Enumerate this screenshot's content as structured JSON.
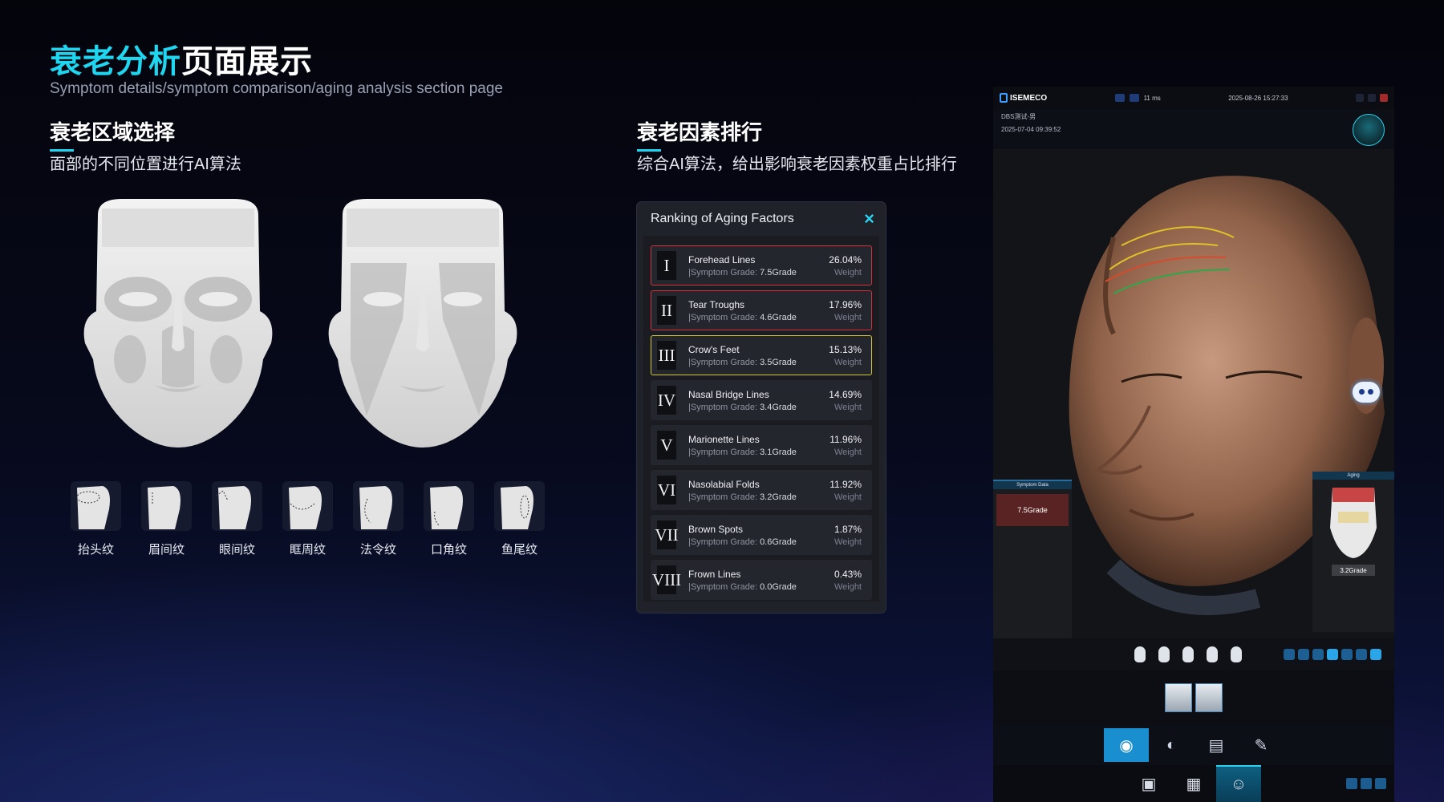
{
  "header": {
    "title_highlight": "衰老分析",
    "title_rest": "页面展示",
    "subtitle": "Symptom details/symptom comparison/aging analysis section page"
  },
  "section_left": {
    "heading": "衰老区域选择",
    "description": "面部的不同位置进行AI算法",
    "zones": [
      {
        "label": "抬头纹",
        "icon": "forehead-zone-icon"
      },
      {
        "label": "眉间纹",
        "icon": "glabella-zone-icon"
      },
      {
        "label": "眼间纹",
        "icon": "eye-zone-icon"
      },
      {
        "label": "眶周纹",
        "icon": "periorbital-zone-icon"
      },
      {
        "label": "法令纹",
        "icon": "nasolabial-zone-icon"
      },
      {
        "label": "口角纹",
        "icon": "mouth-corner-zone-icon"
      },
      {
        "label": "鱼尾纹",
        "icon": "crows-feet-zone-icon"
      }
    ]
  },
  "section_right": {
    "heading": "衰老因素排行",
    "description": "综合AI算法，给出影响衰老因素权重占比排行"
  },
  "ranking_panel": {
    "title": "Ranking of Aging Factors",
    "close_icon": "×",
    "grade_prefix": "Symptom Grade: ",
    "weight_label": "Weight",
    "items": [
      {
        "numeral": "I",
        "name": "Forehead Lines",
        "grade": "7.5Grade",
        "percent": "26.04%"
      },
      {
        "numeral": "II",
        "name": "Tear Troughs",
        "grade": "4.6Grade",
        "percent": "17.96%"
      },
      {
        "numeral": "III",
        "name": "Crow's Feet",
        "grade": "3.5Grade",
        "percent": "15.13%"
      },
      {
        "numeral": "IV",
        "name": "Nasal Bridge Lines",
        "grade": "3.4Grade",
        "percent": "14.69%"
      },
      {
        "numeral": "V",
        "name": "Marionette Lines",
        "grade": "3.1Grade",
        "percent": "11.96%"
      },
      {
        "numeral": "VI",
        "name": "Nasolabial Folds",
        "grade": "3.2Grade",
        "percent": "11.92%"
      },
      {
        "numeral": "VII",
        "name": "Brown Spots",
        "grade": "0.6Grade",
        "percent": "1.87%"
      },
      {
        "numeral": "VIII",
        "name": "Frown Lines",
        "grade": "0.0Grade",
        "percent": "0.43%"
      }
    ]
  },
  "device": {
    "logo": "ISEMECO",
    "latency": "11 ms",
    "datetime": "2025-08-26 15:27:33",
    "user": "DBS测试-男",
    "record_time": "2025-07-04 09:39:52",
    "symptom_panel_title": "Symptom Data",
    "symptom_grade": "7.5Grade",
    "aging_panel_title": "Aging",
    "aging_grade": "3.2Grade"
  },
  "colors": {
    "accent": "#1fd6f0",
    "rank_red": "#d0353d",
    "rank_yellow": "#d6c83a"
  }
}
